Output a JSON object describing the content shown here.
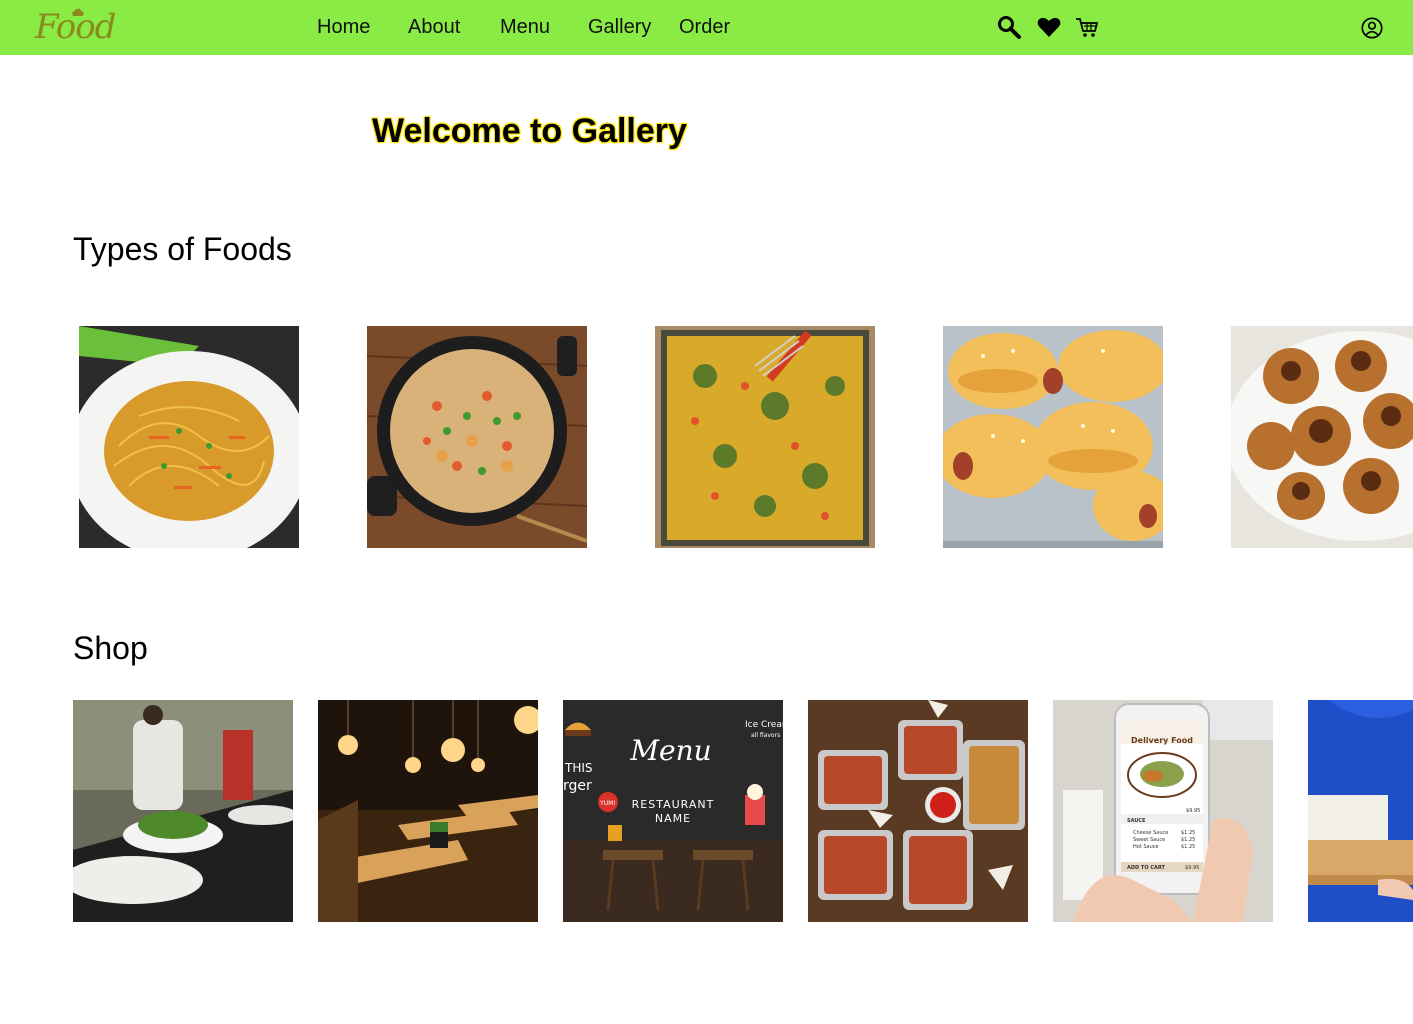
{
  "brand": {
    "logo_text": "Food",
    "accent_color": "#8aeb45",
    "logo_color": "#8a8a1e"
  },
  "nav": {
    "links": [
      "Home",
      "About",
      "Menu",
      "Gallery",
      "Order"
    ],
    "icons": [
      "search-icon",
      "heart-icon",
      "cart-icon",
      "user-icon"
    ]
  },
  "page": {
    "welcome_title": "Welcome to Gallery",
    "types_title": "Types of Foods",
    "shop_title": "Shop"
  },
  "foods": [
    {
      "name": "noodles"
    },
    {
      "name": "fried-rice"
    },
    {
      "name": "frittata"
    },
    {
      "name": "sausage-buns"
    },
    {
      "name": "pecan-rolls"
    }
  ],
  "shop": [
    {
      "name": "kitchen"
    },
    {
      "name": "dining-room"
    },
    {
      "name": "menu-board",
      "text_lines": [
        "Menu",
        "RESTAURANT",
        "NAME",
        "THIS",
        "rger",
        "Ice Cream",
        "all flavors",
        "YUM!"
      ]
    },
    {
      "name": "takeaway-trays"
    },
    {
      "name": "delivery-app",
      "text_lines": [
        "Delivery Food",
        "SAUCE",
        "Cheese Sauce",
        "Sweet Sauce",
        "Hot Sauce",
        "$1.25",
        "$1.25",
        "$1.25",
        "$9.95",
        "ADD TO CART",
        "$9.95"
      ]
    },
    {
      "name": "delivery-courier"
    }
  ]
}
